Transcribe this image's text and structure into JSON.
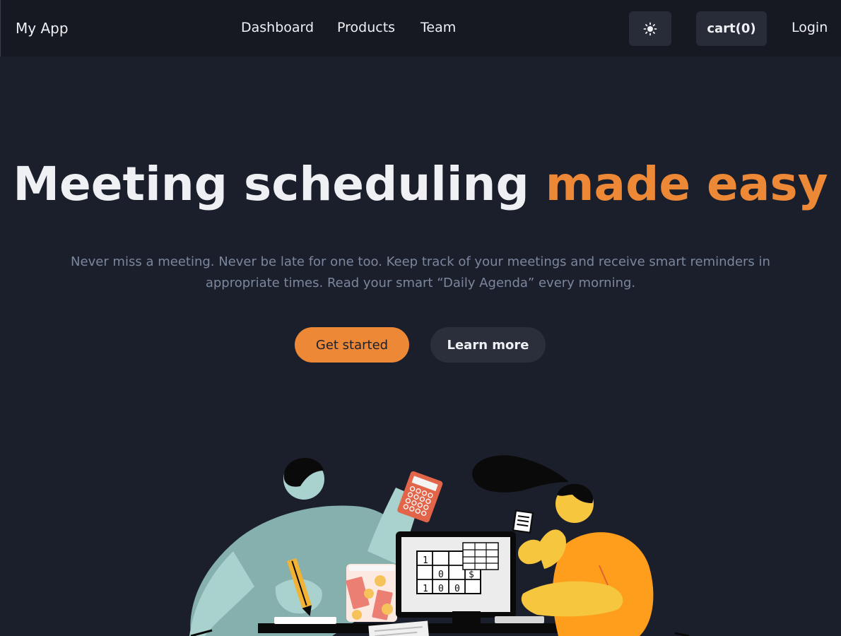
{
  "nav": {
    "brand": "My App",
    "links": [
      "Dashboard",
      "Products",
      "Team"
    ],
    "theme_icon": "sun-icon",
    "cart_label": "cart(0)",
    "login_label": "Login"
  },
  "hero": {
    "title_main": "Meeting scheduling ",
    "title_accent": "made easy",
    "subtitle": "Never miss a meeting. Never be late for one too. Keep track of your meetings and receive smart reminders in appropriate times. Read your smart “Daily Agenda” every morning.",
    "primary_cta": "Get started",
    "secondary_cta": "Learn more"
  },
  "illustration": {
    "name": "people-scheduling-illustration"
  },
  "colors": {
    "background": "#1b1f2c",
    "navbar": "#161922",
    "accent": "#ed8936",
    "subtitle": "#7b879c",
    "button_dark": "#2b2f3b"
  }
}
